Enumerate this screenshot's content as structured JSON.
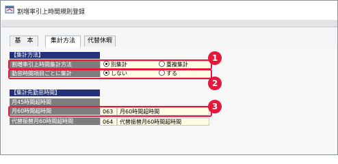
{
  "window": {
    "title": "割増率引上時間規則登録"
  },
  "tabs": [
    {
      "label": "基　本"
    },
    {
      "label": "集計方法"
    },
    {
      "label": "代替休暇"
    }
  ],
  "section_method": {
    "header": "【集計方法】",
    "rows": [
      {
        "label": "割増率引上時間集計方法",
        "option1": "別集計",
        "option2": "重複集計",
        "selected": 1
      },
      {
        "label": "勤怠時間項目ごとに集計",
        "option1": "しない",
        "option2": "する",
        "selected": 1
      }
    ]
  },
  "section_target": {
    "header": "【集計先勤怠時間】",
    "rows": [
      {
        "label": "月45時間超時間",
        "code": "",
        "name": ""
      },
      {
        "label": "月60時間超時間",
        "code": "063",
        "name": "月60時間超時間"
      },
      {
        "label": "代替振替月60時間超時間",
        "code": "064",
        "name": "代替振替月60時間超時間"
      }
    ]
  },
  "callouts": [
    "1",
    "2",
    "3"
  ],
  "colors": {
    "accent": "#e5173a",
    "section_header": "#23327a",
    "label_bg": "#7d7d7d",
    "cell_bg": "#fffde4"
  }
}
